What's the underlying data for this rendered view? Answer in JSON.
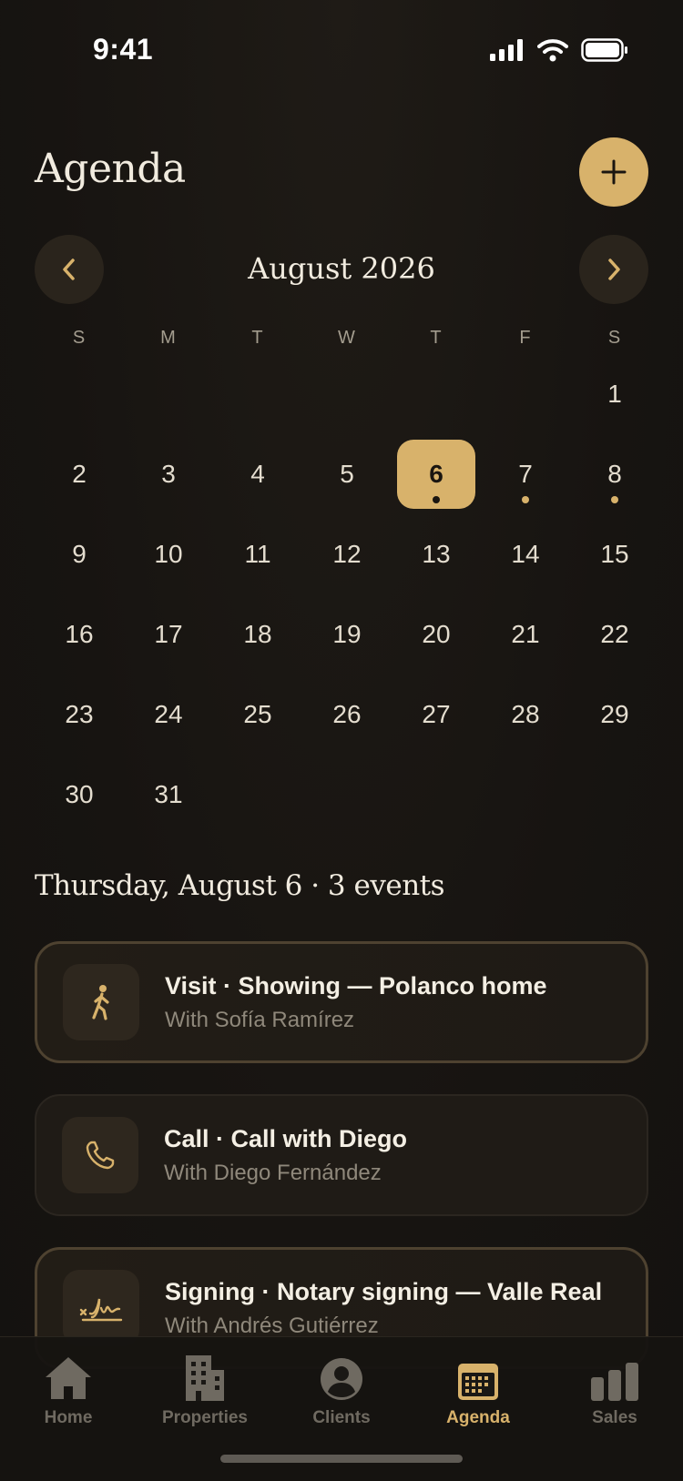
{
  "status": {
    "time": "9:41"
  },
  "header": {
    "title": "Agenda"
  },
  "calendar": {
    "month_label": "August 2026",
    "weekdays": [
      "S",
      "M",
      "T",
      "W",
      "T",
      "F",
      "S"
    ],
    "selected_day": "6",
    "days_with_events": [
      "6",
      "7",
      "8"
    ]
  },
  "events_section": {
    "heading": "Thursday, August 6 · 3 events",
    "events": [
      {
        "title": "Visit · Showing — Polanco home",
        "subtitle": "With Sofía Ramírez",
        "icon": "walking-person-icon"
      },
      {
        "title": "Call · Call with Diego",
        "subtitle": "With Diego Fernández",
        "icon": "phone-icon"
      },
      {
        "title": "Signing · Notary signing — Valle Real",
        "subtitle": "With Andrés Gutiérrez",
        "icon": "signature-icon"
      }
    ]
  },
  "tabbar": {
    "items": [
      {
        "label": "Home",
        "icon": "house-icon"
      },
      {
        "label": "Properties",
        "icon": "building-icon"
      },
      {
        "label": "Clients",
        "icon": "person-circle-icon"
      },
      {
        "label": "Agenda",
        "icon": "calendar-icon"
      },
      {
        "label": "Sales",
        "icon": "bar-chart-icon"
      }
    ],
    "active": "Agenda"
  },
  "colors": {
    "accent": "#d8b26b",
    "background": "#181511",
    "inactive": "#6f6a61"
  }
}
